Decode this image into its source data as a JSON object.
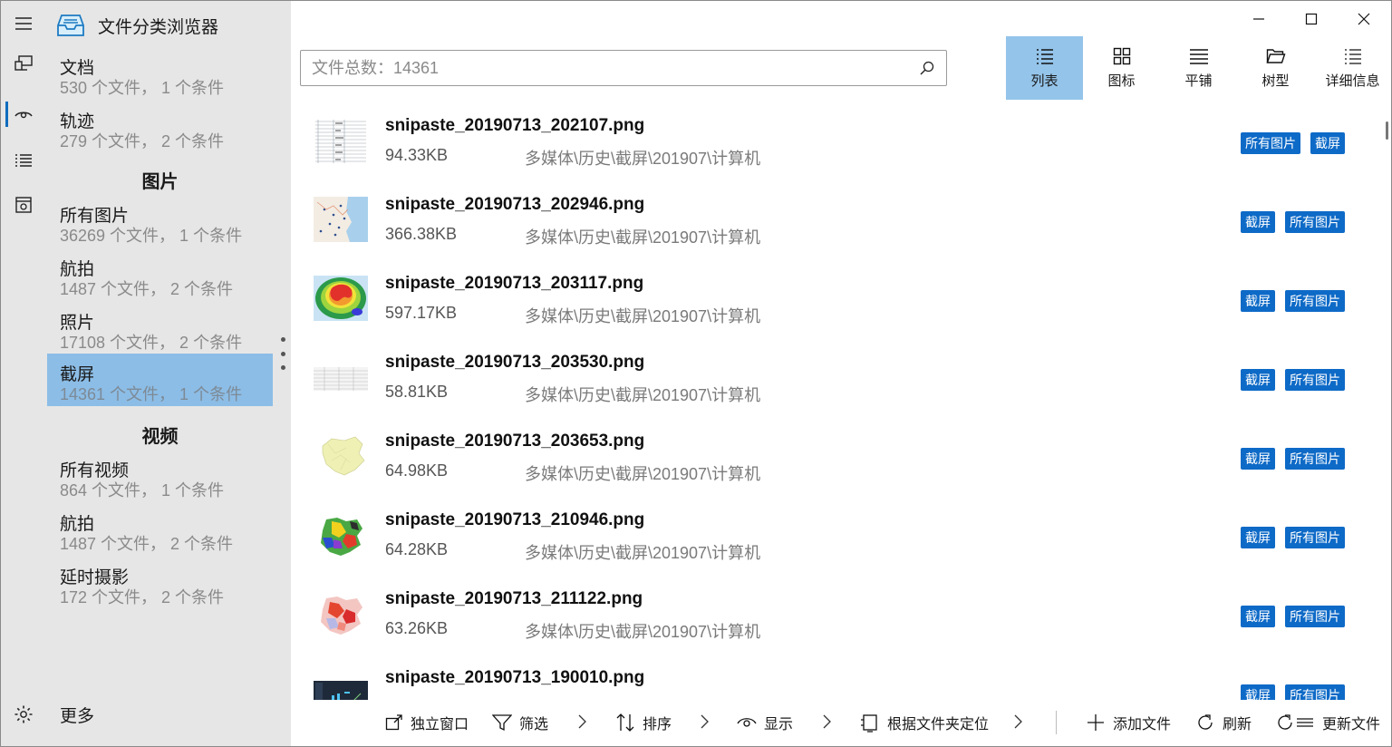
{
  "app": {
    "title": "文件分类浏览器"
  },
  "sidebar": {
    "items_top": [
      {
        "label": "文档",
        "sub": "530 个文件， 1 个条件"
      },
      {
        "label": "轨迹",
        "sub": "279 个文件， 2 个条件"
      }
    ],
    "group_images": "图片",
    "items_images": [
      {
        "label": "所有图片",
        "sub": "36269 个文件， 1 个条件"
      },
      {
        "label": "航拍",
        "sub": "1487 个文件， 2 个条件"
      },
      {
        "label": "照片",
        "sub": "17108 个文件， 2 个条件"
      },
      {
        "label": "截屏",
        "sub": "14361 个文件， 1 个条件",
        "selected": true
      }
    ],
    "group_videos": "视频",
    "items_videos": [
      {
        "label": "所有视频",
        "sub": "864 个文件， 1 个条件"
      },
      {
        "label": "航拍",
        "sub": "1487 个文件， 2 个条件"
      },
      {
        "label": "延时摄影",
        "sub": "172 个文件， 2 个条件"
      }
    ],
    "more_label": "更多"
  },
  "search": {
    "placeholder": "文件总数：14361",
    "value": ""
  },
  "views": [
    {
      "label": "列表",
      "icon": "list-view-icon",
      "active": true
    },
    {
      "label": "图标",
      "icon": "grid-view-icon"
    },
    {
      "label": "平铺",
      "icon": "tile-view-icon"
    },
    {
      "label": "树型",
      "icon": "folder-tree-icon"
    },
    {
      "label": "详细信息",
      "icon": "details-view-icon"
    }
  ],
  "files": [
    {
      "name": "snipaste_20190713_202107.png",
      "size": "94.33KB",
      "path": "多媒体\\历史\\截屏\\201907\\计算机",
      "tags": [
        "所有图片",
        "截屏"
      ],
      "thumb": "table"
    },
    {
      "name": "snipaste_20190713_202946.png",
      "size": "366.38KB",
      "path": "多媒体\\历史\\截屏\\201907\\计算机",
      "tags": [
        "截屏",
        "所有图片"
      ],
      "thumb": "map-blue"
    },
    {
      "name": "snipaste_20190713_203117.png",
      "size": "597.17KB",
      "path": "多媒体\\历史\\截屏\\201907\\计算机",
      "tags": [
        "截屏",
        "所有图片"
      ],
      "thumb": "heatmap"
    },
    {
      "name": "snipaste_20190713_203530.png",
      "size": "58.81KB",
      "path": "多媒体\\历史\\截屏\\201907\\计算机",
      "tags": [
        "截屏",
        "所有图片"
      ],
      "thumb": "table-light"
    },
    {
      "name": "snipaste_20190713_203653.png",
      "size": "64.98KB",
      "path": "多媒体\\历史\\截屏\\201907\\计算机",
      "tags": [
        "截屏",
        "所有图片"
      ],
      "thumb": "map-yellow"
    },
    {
      "name": "snipaste_20190713_210946.png",
      "size": "64.28KB",
      "path": "多媒体\\历史\\截屏\\201907\\计算机",
      "tags": [
        "截屏",
        "所有图片"
      ],
      "thumb": "map-multi"
    },
    {
      "name": "snipaste_20190713_211122.png",
      "size": "63.26KB",
      "path": "多媒体\\历史\\截屏\\201907\\计算机",
      "tags": [
        "截屏",
        "所有图片"
      ],
      "thumb": "map-red"
    },
    {
      "name": "snipaste_20190713_190010.png",
      "size": "",
      "path": "",
      "tags": [
        "截屏",
        "所有图片"
      ],
      "thumb": "dark-ui"
    }
  ],
  "commands": {
    "standalone": "独立窗口",
    "filter": "筛选",
    "sort": "排序",
    "display": "显示",
    "locate_by_folder": "根据文件夹定位",
    "add_file": "添加文件",
    "refresh": "刷新",
    "update_file": "更新文件"
  },
  "colors": {
    "accent": "#0e6ac7",
    "selected_bg": "#8cbde6",
    "sidebar_bg": "#e6e6e6"
  }
}
